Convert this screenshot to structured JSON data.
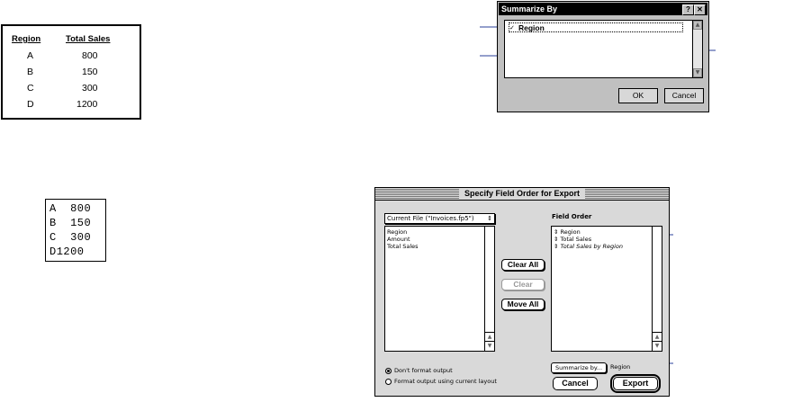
{
  "report": {
    "headers": [
      "Region",
      "Total Sales"
    ],
    "rows": [
      [
        "A",
        "800"
      ],
      [
        "B",
        "150"
      ],
      [
        "C",
        "300"
      ],
      [
        "D",
        "1200"
      ]
    ]
  },
  "mono_output": [
    "A  800",
    "B  150",
    "C  300",
    "D1200"
  ],
  "summarize_dialog": {
    "title": "Summarize By",
    "help_label": "?",
    "close_label": "✕",
    "selected_item": "Region",
    "scroll_up": "▲",
    "scroll_down": "▼",
    "ok_label": "OK",
    "cancel_label": "Cancel"
  },
  "export_dialog": {
    "title": "Specify Field Order for Export",
    "file_popup": "Current File (\"Invoices.fp5\")",
    "popup_arrow": "⇕",
    "source_fields": [
      "Region",
      "Amount",
      "Total Sales"
    ],
    "field_order_label": "Field Order",
    "field_order": [
      "Region",
      "Total Sales",
      "Total Sales by Region"
    ],
    "order_marker": "⇕",
    "scroll_up": "▲",
    "scroll_down": "▼",
    "clear_all_label": "Clear All",
    "clear_label": "Clear",
    "move_all_label": "Move All",
    "radio_dont_format": "Don't format output",
    "radio_format_layout": "Format output using current layout",
    "summarize_button": "Summarize by...",
    "summarize_value": "Region",
    "cancel_label": "Cancel",
    "export_label": "Export"
  }
}
